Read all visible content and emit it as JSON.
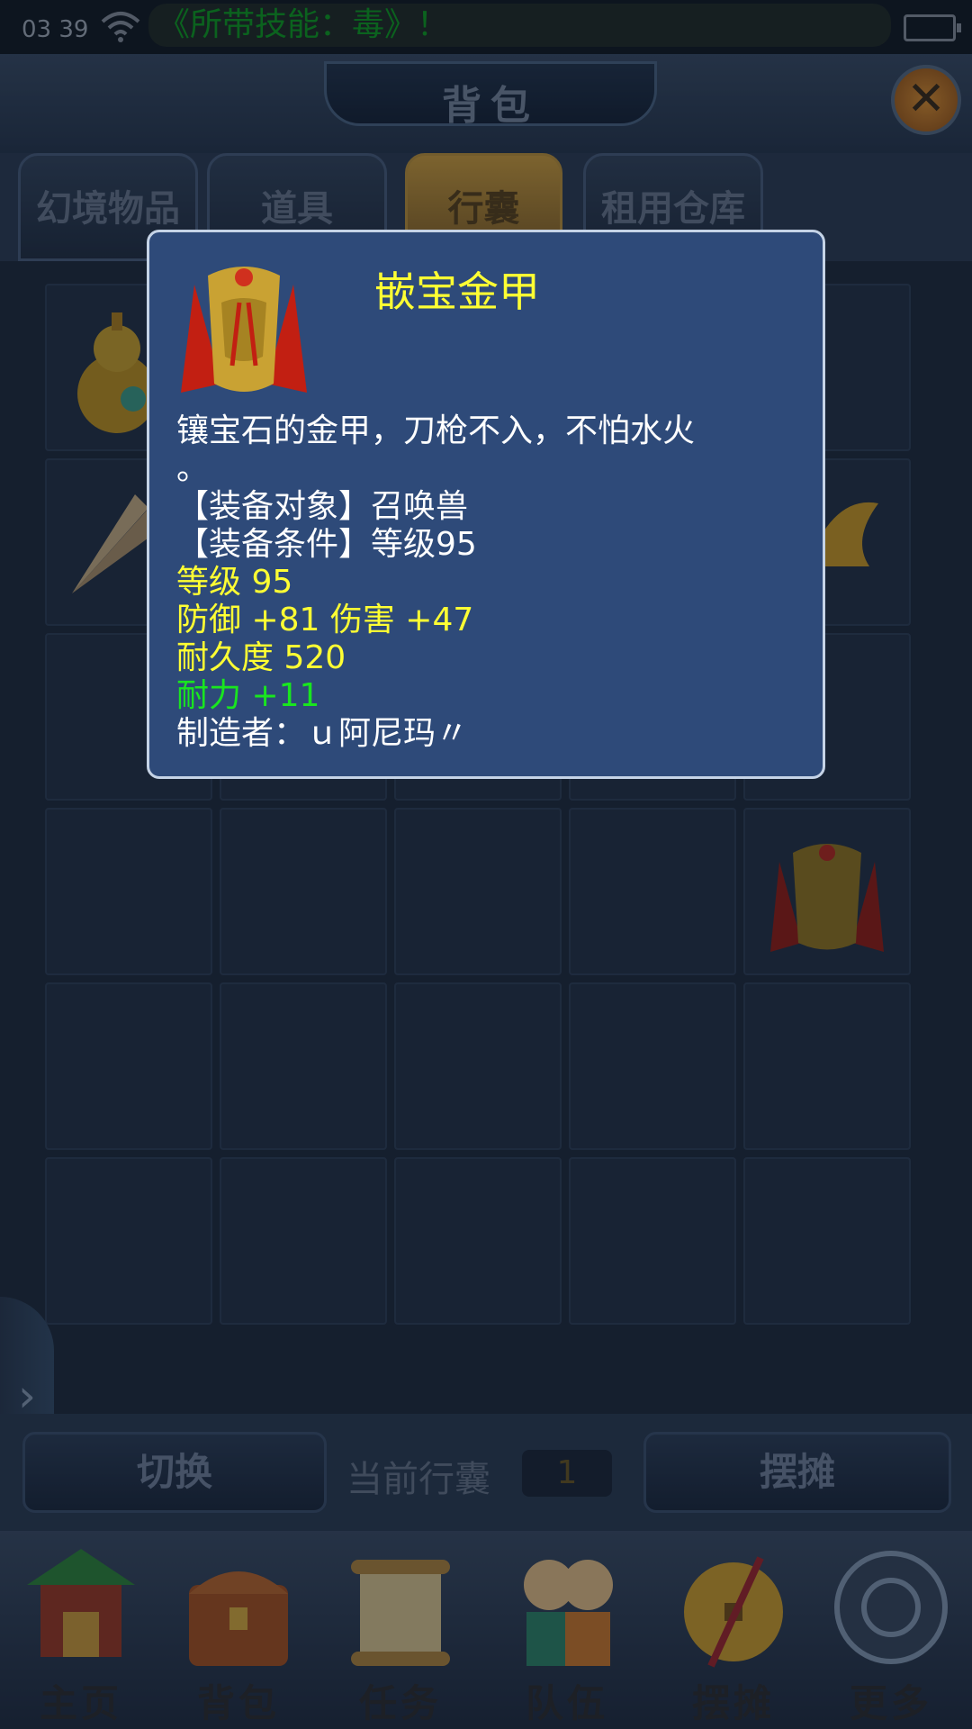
{
  "status_bar": {
    "time": "03 39",
    "marquee": "《所带技能：毒》！"
  },
  "header": {
    "title": "背包"
  },
  "tabs": [
    {
      "label": "幻境物品"
    },
    {
      "label": "道具"
    },
    {
      "label": "行囊"
    },
    {
      "label": "租用仓库"
    }
  ],
  "bottom_bar": {
    "switch_label": "切换",
    "current_label": "当前行囊",
    "current_value": "1",
    "stall_label": "摆摊"
  },
  "nav": [
    {
      "label": "主页",
      "icon": "pavilion-icon"
    },
    {
      "label": "背包",
      "icon": "treasure-chest-icon"
    },
    {
      "label": "任务",
      "icon": "scroll-icon"
    },
    {
      "label": "队伍",
      "icon": "team-icon"
    },
    {
      "label": "摆摊",
      "icon": "coin-icon"
    },
    {
      "label": "更多",
      "icon": "more-icon"
    }
  ],
  "tooltip": {
    "title": "嵌宝金甲",
    "description_1": "镶宝石的金甲，刀枪不入，不怕水火",
    "description_2": "。",
    "target": "【装备对象】召唤兽",
    "requirement": "【装备条件】等级95",
    "level": "等级  95",
    "defense_damage": "防御  +81  伤害  +47",
    "durability": "耐久度  520",
    "stamina": "耐力  +11",
    "maker": "制造者：ｕ阿尼玛〃"
  },
  "colors": {
    "tooltip_bg": "#2e4a79",
    "title_yellow": "#ffff33",
    "stat_green": "#19e61f",
    "active_tab": "#d9a63c"
  }
}
